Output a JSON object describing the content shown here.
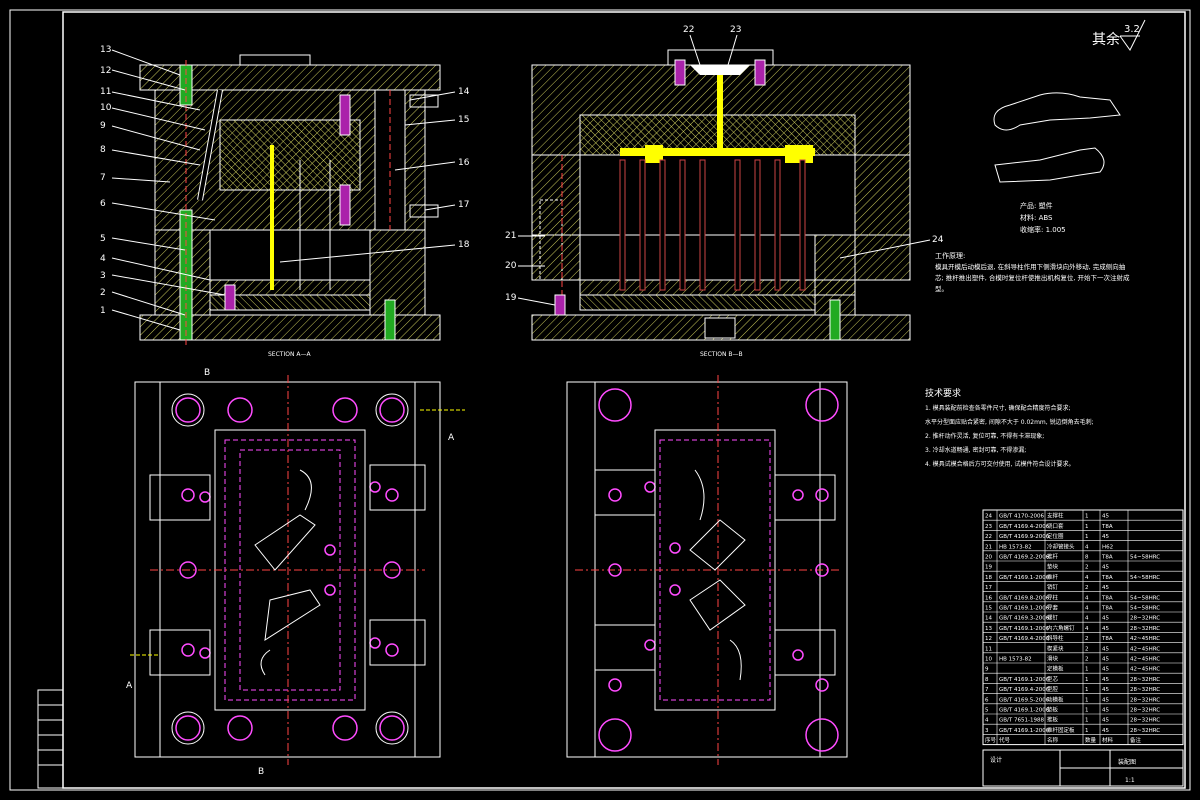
{
  "drawing": {
    "roughness_label": "其余",
    "roughness_value": "3.2",
    "section_aa_caption": "SECTION A—A",
    "section_bb_caption": "SECTION B—B",
    "cut_labels": {
      "a": "A",
      "b": "B"
    },
    "callouts_left": [
      "13",
      "12",
      "11",
      "10",
      "9",
      "8",
      "7",
      "6",
      "5",
      "4",
      "3",
      "2",
      "1"
    ],
    "callouts_right_aa": [
      "14",
      "15",
      "16",
      "17",
      "18"
    ],
    "callouts_bb_top": [
      "22",
      "23"
    ],
    "callouts_bb_left": [
      "21",
      "20",
      "19"
    ],
    "callouts_bb_right": [
      "24"
    ],
    "product_lines": [
      "产品: 塑件",
      "材料: ABS",
      "收缩率: 1.005"
    ],
    "work_principle": {
      "title": "工作原理:",
      "body": "模具开模后动模后退, 在斜导柱作用下侧滑块向外移动, 完成侧向抽芯; 推杆推出塑件, 合模时复位杆使推出机构复位, 开始下一次注射成型。"
    },
    "tech_req": {
      "title": "技术要求",
      "items": [
        "1. 模具装配前检查各零件尺寸, 确保配合精度符合要求;",
        "水平分型面应贴合紧密, 间隙不大于 0.02mm, 锐边倒角去毛刺;",
        "2. 推杆动作灵活, 复位可靠, 不得有卡滞现象;",
        "3. 冷却水道畅通, 密封可靠, 不得渗漏;",
        "4. 模具试模合格后方可交付使用, 试模件符合设计要求。"
      ]
    },
    "bom": {
      "rows": [
        [
          "24",
          "GB/T 4170-2006",
          "支撑柱",
          "1",
          "45",
          ""
        ],
        [
          "23",
          "GB/T 4169.4-2006",
          "浇口套",
          "1",
          "T8A",
          ""
        ],
        [
          "22",
          "GB/T 4169.9-2006",
          "定位圈",
          "1",
          "45",
          ""
        ],
        [
          "21",
          "HB 1573-82",
          "冷却管接头",
          "4",
          "H62",
          ""
        ],
        [
          "20",
          "GB/T 4169.2-2006",
          "推杆",
          "8",
          "T8A",
          "54~58HRC"
        ],
        [
          "19",
          "",
          "垫块",
          "2",
          "45",
          ""
        ],
        [
          "18",
          "GB/T 4169.1-2006",
          "推杆",
          "4",
          "T8A",
          "54~58HRC"
        ],
        [
          "17",
          "",
          "销钉",
          "2",
          "45",
          ""
        ],
        [
          "16",
          "GB/T 4169.8-2006",
          "导柱",
          "4",
          "T8A",
          "54~58HRC"
        ],
        [
          "15",
          "GB/T 4169.1-2006",
          "导套",
          "4",
          "T8A",
          "54~58HRC"
        ],
        [
          "14",
          "GB/T 4169.3-2006",
          "螺钉",
          "4",
          "45",
          "28~32HRC"
        ],
        [
          "13",
          "GB/T 4169.1-2006",
          "内六角螺钉",
          "4",
          "45",
          "28~32HRC"
        ],
        [
          "12",
          "GB/T 4169.4-2006",
          "斜导柱",
          "2",
          "T8A",
          "42~45HRC"
        ],
        [
          "11",
          "",
          "楔紧块",
          "2",
          "45",
          "42~45HRC"
        ],
        [
          "10",
          "HB 1573-82",
          "滑块",
          "2",
          "45",
          "42~45HRC"
        ],
        [
          "9",
          "",
          "定模板",
          "1",
          "45",
          "42~45HRC"
        ],
        [
          "8",
          "GB/T 4169.1-2006",
          "型芯",
          "1",
          "45",
          "28~32HRC"
        ],
        [
          "7",
          "GB/T 4169.4-2006",
          "型腔",
          "1",
          "45",
          "28~32HRC"
        ],
        [
          "6",
          "GB/T 4169.5-2006",
          "动模板",
          "1",
          "45",
          "28~32HRC"
        ],
        [
          "5",
          "GB/T 4169.1-2006",
          "垫板",
          "1",
          "45",
          "28~32HRC"
        ],
        [
          "4",
          "GB/T 7651-1988",
          "推板",
          "1",
          "45",
          "28~32HRC"
        ],
        [
          "3",
          "GB/T 4169.1-2006",
          "推杆固定板",
          "1",
          "45",
          "28~32HRC"
        ]
      ],
      "header": [
        "序号",
        "代号",
        "名称",
        "数量",
        "材料",
        "备注"
      ],
      "title_block": {
        "assembly": "装配图",
        "scale": "1:1",
        "designer": "设计"
      }
    },
    "side_block": [
      "",
      "",
      "",
      "",
      "",
      ""
    ]
  }
}
